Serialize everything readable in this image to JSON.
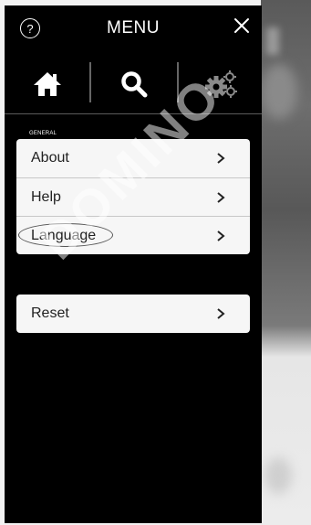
{
  "header": {
    "help_glyph": "?",
    "title": "MENU",
    "close_icon": "close-icon"
  },
  "tabs": [
    {
      "icon": "home-icon",
      "active": true
    },
    {
      "icon": "search-icon",
      "active": true
    },
    {
      "icon": "gears-icon",
      "active": false
    }
  ],
  "general": {
    "section_label": "GENERAL",
    "items": [
      {
        "label": "About"
      },
      {
        "label": "Help"
      },
      {
        "label": "Language",
        "highlighted": true
      }
    ]
  },
  "reset": {
    "label": "Reset"
  },
  "watermark": "DOMINO",
  "colors": {
    "panel": "#000000",
    "card": "#f6f6f6",
    "text": "#222222",
    "icon_active": "#ffffff",
    "icon_inactive": "#8a8a8a"
  }
}
